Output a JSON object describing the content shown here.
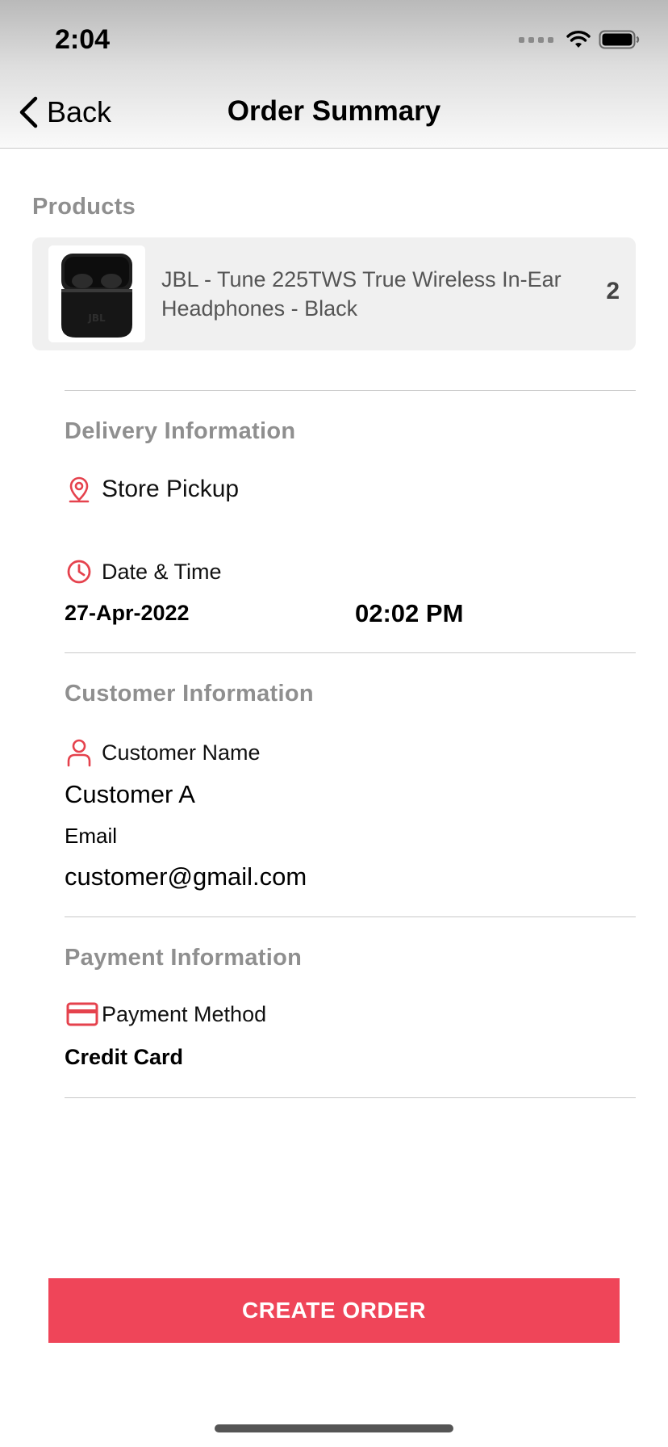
{
  "status_bar": {
    "time": "2:04"
  },
  "nav": {
    "back_label": "Back",
    "title": "Order Summary"
  },
  "products": {
    "heading": "Products",
    "items": [
      {
        "name": "JBL - Tune 225TWS True Wireless In-Ear Headphones - Black",
        "quantity": "2"
      }
    ]
  },
  "delivery": {
    "heading": "Delivery  Information",
    "method": "Store Pickup",
    "datetime_label": "Date & Time",
    "date": "27-Apr-2022",
    "time": "02:02 PM"
  },
  "customer": {
    "heading": "Customer  Information",
    "name_label": "Customer  Name",
    "name": "Customer A",
    "email_label": "Email",
    "email": "customer@gmail.com"
  },
  "payment": {
    "heading": "Payment  Information",
    "method_label": "Payment Method",
    "method": "Credit Card"
  },
  "actions": {
    "create_order": "CREATE ORDER"
  },
  "colors": {
    "accent": "#ef4559",
    "heading_gray": "#8f8f8f",
    "card_bg": "#f0f0f0"
  },
  "icons": [
    "back-chevron-icon",
    "wifi-icon",
    "battery-icon",
    "location-pin-icon",
    "clock-icon",
    "person-icon",
    "credit-card-icon"
  ]
}
